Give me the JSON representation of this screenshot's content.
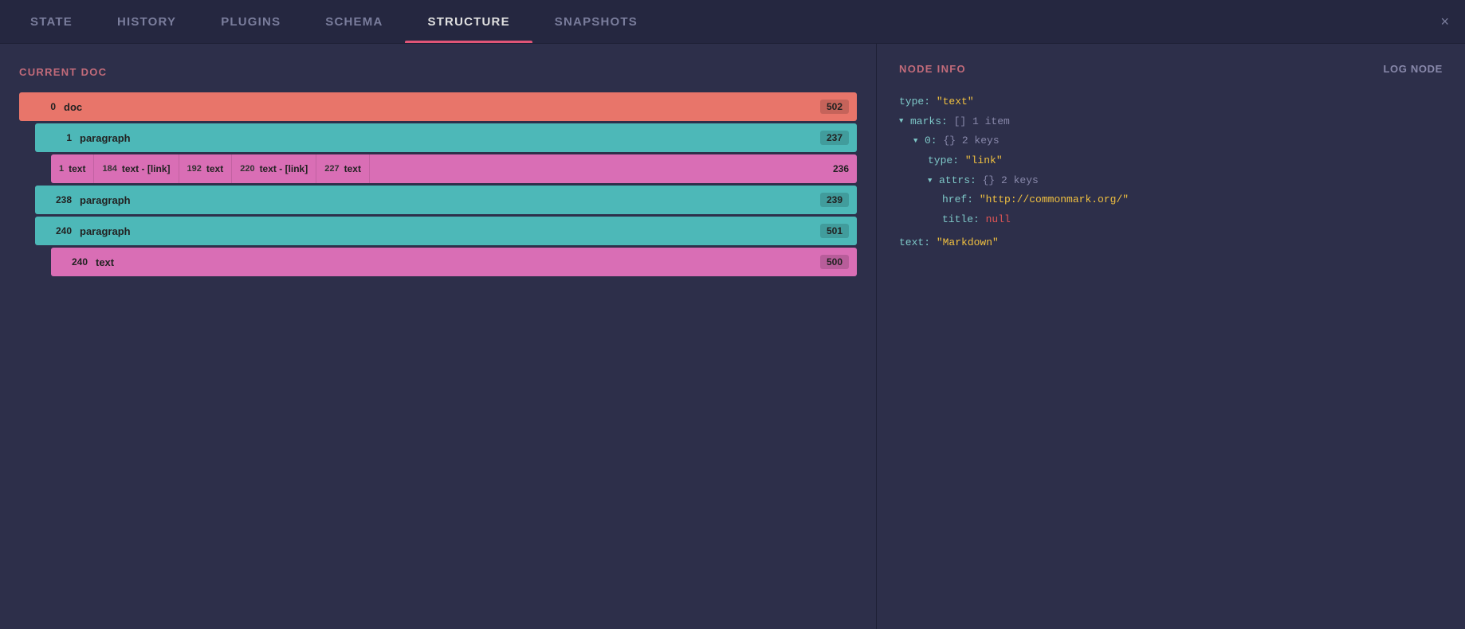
{
  "tabs": [
    {
      "label": "STATE",
      "active": false
    },
    {
      "label": "HISTORY",
      "active": false
    },
    {
      "label": "PLUGINS",
      "active": false
    },
    {
      "label": "SCHEMA",
      "active": false
    },
    {
      "label": "STRUCTURE",
      "active": true
    },
    {
      "label": "SNAPSHOTS",
      "active": false
    }
  ],
  "close_btn": "×",
  "left": {
    "section_title": "CURRENT DOC",
    "doc_row": {
      "pos_start": "0",
      "label": "doc",
      "pos_end": "502"
    },
    "paragraph1": {
      "pos_start": "1",
      "label": "paragraph",
      "pos_end": "237"
    },
    "inline_nodes": [
      {
        "pos_start": "1",
        "label": "text",
        "pos_mid": "184"
      },
      {
        "label": "text - [link]",
        "pos_mid": "192"
      },
      {
        "label": "text",
        "pos_mid": "220"
      },
      {
        "label": "text - [link]",
        "pos_mid": "227"
      },
      {
        "label": "text",
        "pos_end": "236"
      }
    ],
    "paragraph2": {
      "pos_start": "238",
      "label": "paragraph",
      "pos_end": "239"
    },
    "paragraph3": {
      "pos_start": "240",
      "label": "paragraph",
      "pos_end": "501"
    },
    "text_node": {
      "pos_start": "240",
      "label": "text",
      "pos_end": "500"
    }
  },
  "right": {
    "section_title": "NODE INFO",
    "log_btn": "LOG NODE",
    "info": {
      "type_key": "type:",
      "type_val": "\"text\"",
      "marks_key": "marks:",
      "marks_meta": "[] 1 item",
      "marks_0_key": "0:",
      "marks_0_meta": "{} 2 keys",
      "marks_0_type_key": "type:",
      "marks_0_type_val": "\"link\"",
      "attrs_key": "attrs:",
      "attrs_meta": "{} 2 keys",
      "href_key": "href:",
      "href_val": "\"http://commonmark.org/\"",
      "title_key": "title:",
      "title_val": "null",
      "text_key": "text:",
      "text_val": "\"Markdown\""
    }
  }
}
